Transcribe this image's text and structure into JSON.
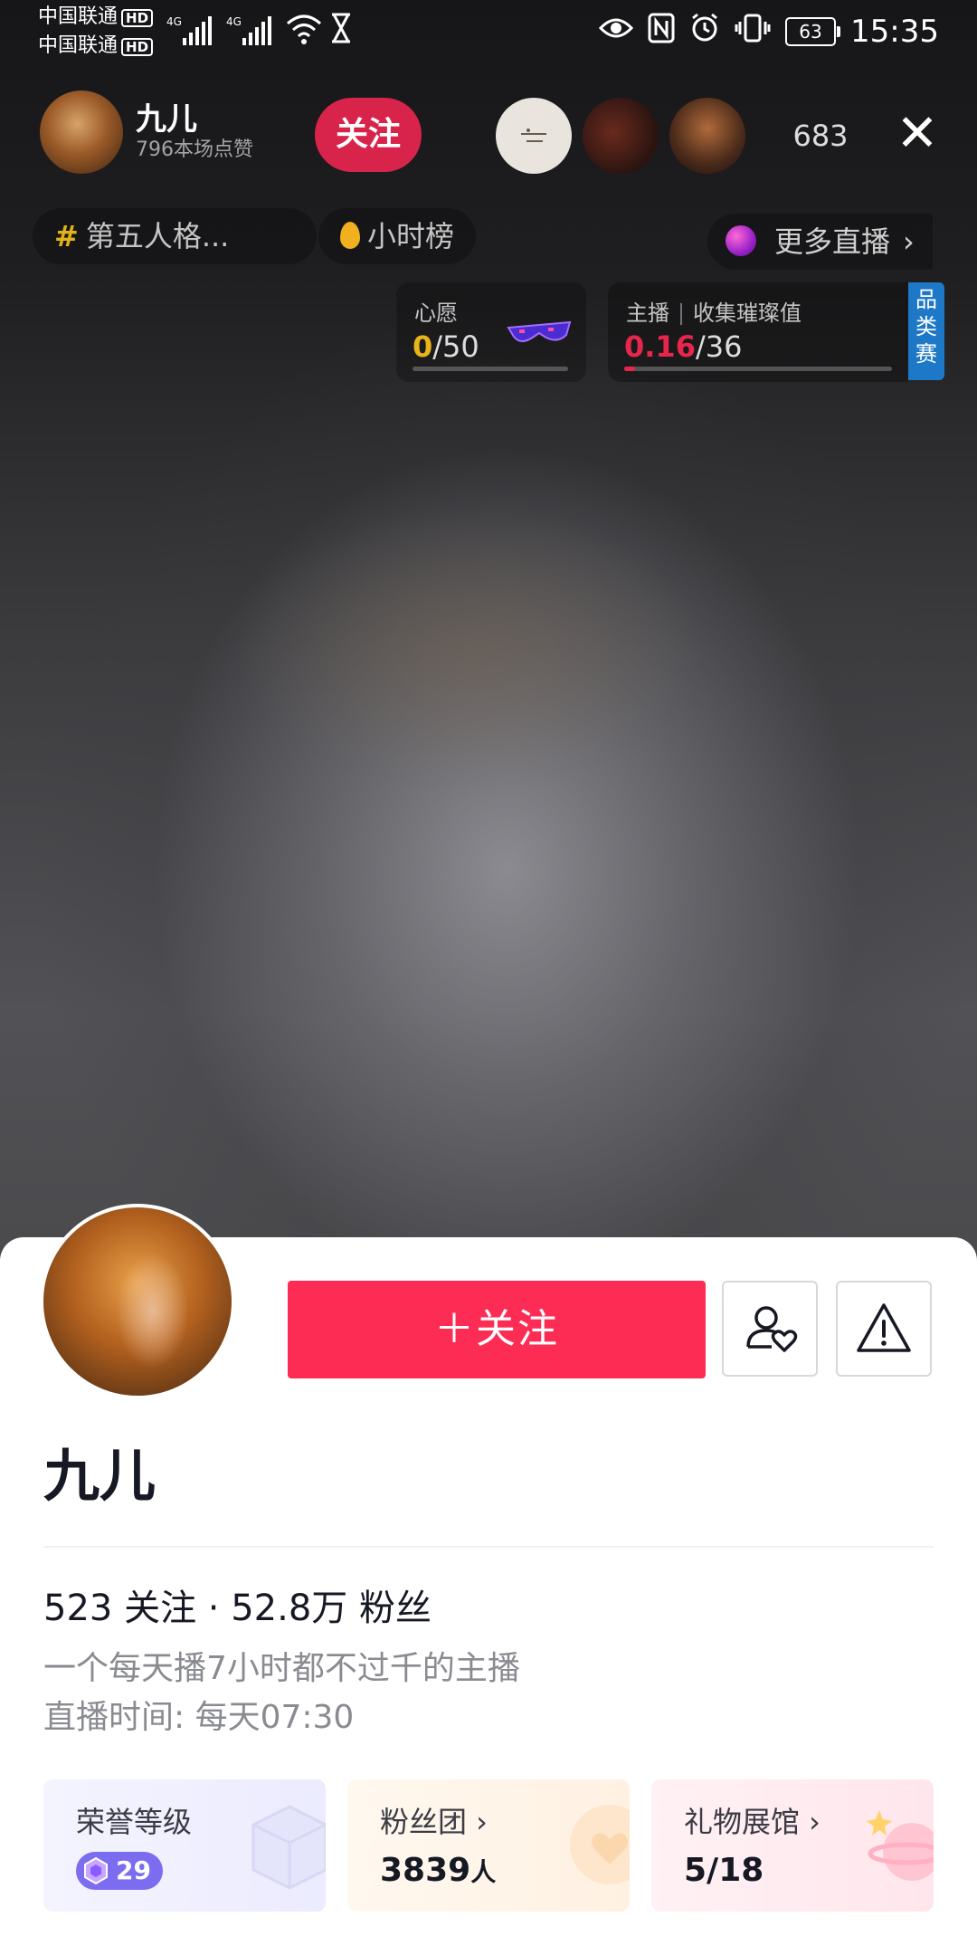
{
  "status_bar": {
    "carrier1": "中国联通",
    "carrier2": "中国联通",
    "hd": "HD",
    "network": "4G",
    "battery": "63",
    "time": "15:35"
  },
  "live": {
    "host_name": "九儿",
    "likes": "796本场点赞",
    "follow_label": "关注",
    "viewer_count": "683",
    "close": "✕",
    "tags": [
      {
        "label": "第五人格..."
      },
      {
        "label": "小时榜"
      }
    ],
    "more_live": "更多直播",
    "wish": {
      "label": "心愿",
      "current": "0",
      "total": "/50",
      "progress": 0
    },
    "collect": {
      "label_a": "主播",
      "label_b": "收集璀璨值",
      "current": "0.16",
      "total": "/36",
      "progress": 0.0044
    },
    "rank_badge": "品类赛"
  },
  "profile": {
    "follow_button": "＋关注",
    "name": "九儿",
    "following_count": "523",
    "following_label": "关注",
    "dot": "·",
    "fans_count": "52.8万",
    "fans_label": "粉丝",
    "bio": "一个每天播7小时都不过千的主播",
    "live_time": "直播时间: 每天07:30",
    "cards": {
      "honor": {
        "title": "荣誉等级",
        "level": "29"
      },
      "fan_club": {
        "title": "粉丝团 ›",
        "value": "3839",
        "unit": "人"
      },
      "gift_hall": {
        "title": "礼物展馆 ›",
        "value": "5/18"
      }
    }
  },
  "colors": {
    "accent": "#fd2c55",
    "follow_top": "#d8234a",
    "wish_number": "#e8b41a",
    "collect_number": "#e8264c",
    "level_badge": "#7b6cf0",
    "rank_badge": "#1e78c8"
  }
}
